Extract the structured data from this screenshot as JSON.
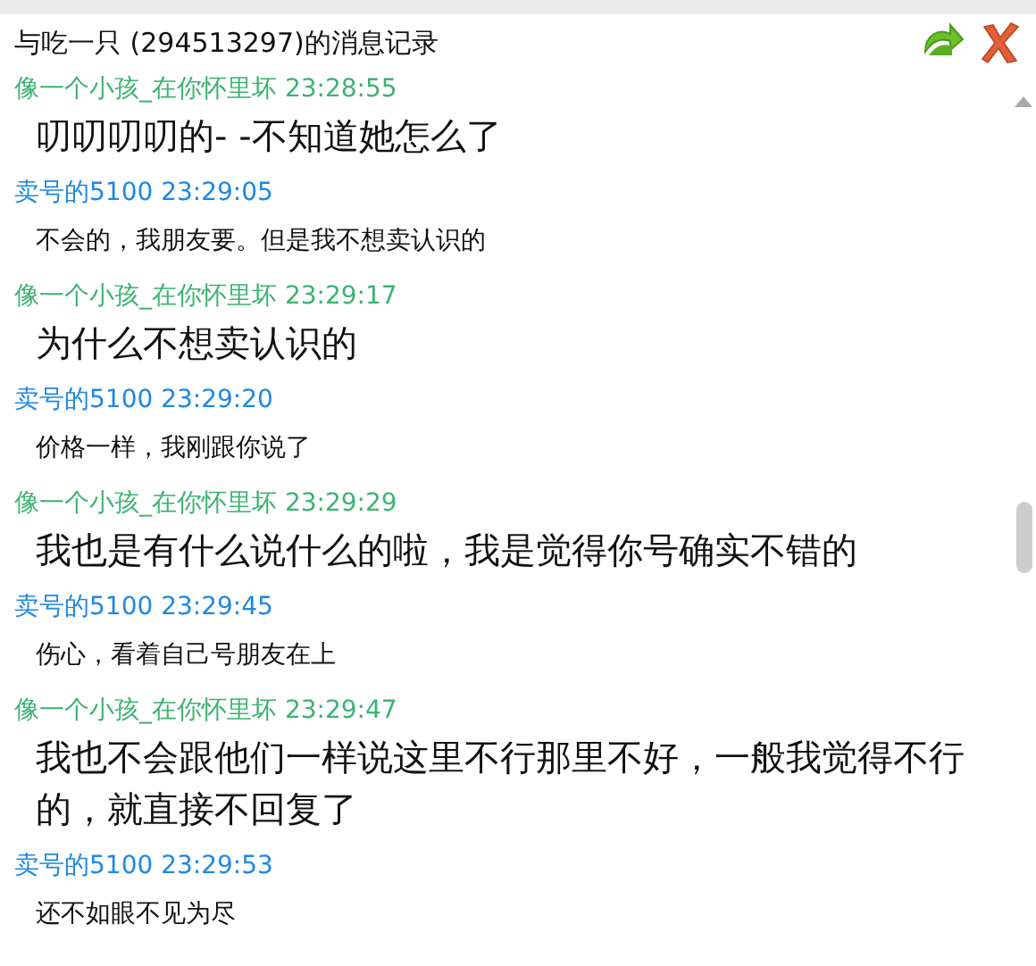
{
  "window": {
    "title": "与吃一只 (294513297)的消息记录"
  },
  "messages": [
    {
      "sender": "像一个小孩_在你怀里坏",
      "time": "23:28:55",
      "color": "#3cb371",
      "kind": "large",
      "text": "叨叨叨叨的- -不知道她怎么了"
    },
    {
      "sender": "卖号的5100",
      "time": "23:29:05",
      "color": "#1e88e5",
      "kind": "normal",
      "text": "不会的，我朋友要。但是我不想卖认识的"
    },
    {
      "sender": "像一个小孩_在你怀里坏",
      "time": "23:29:17",
      "color": "#3cb371",
      "kind": "large",
      "text": "为什么不想卖认识的"
    },
    {
      "sender": "卖号的5100",
      "time": "23:29:20",
      "color": "#1e88e5",
      "kind": "normal",
      "text": "价格一样，我刚跟你说了"
    },
    {
      "sender": "像一个小孩_在你怀里坏",
      "time": "23:29:29",
      "color": "#3cb371",
      "kind": "large",
      "text": "我也是有什么说什么的啦，我是觉得你号确实不错的"
    },
    {
      "sender": "卖号的5100",
      "time": "23:29:45",
      "color": "#1e88e5",
      "kind": "normal",
      "text": "伤心，看着自己号朋友在上"
    },
    {
      "sender": "像一个小孩_在你怀里坏",
      "time": "23:29:47",
      "color": "#3cb371",
      "kind": "large",
      "text": "我也不会跟他们一样说这里不行那里不好，一般我觉得不行的，就直接不回复了"
    },
    {
      "sender": "卖号的5100",
      "time": "23:29:53",
      "color": "#1e88e5",
      "kind": "normal",
      "text": "还不如眼不见为尽"
    }
  ]
}
